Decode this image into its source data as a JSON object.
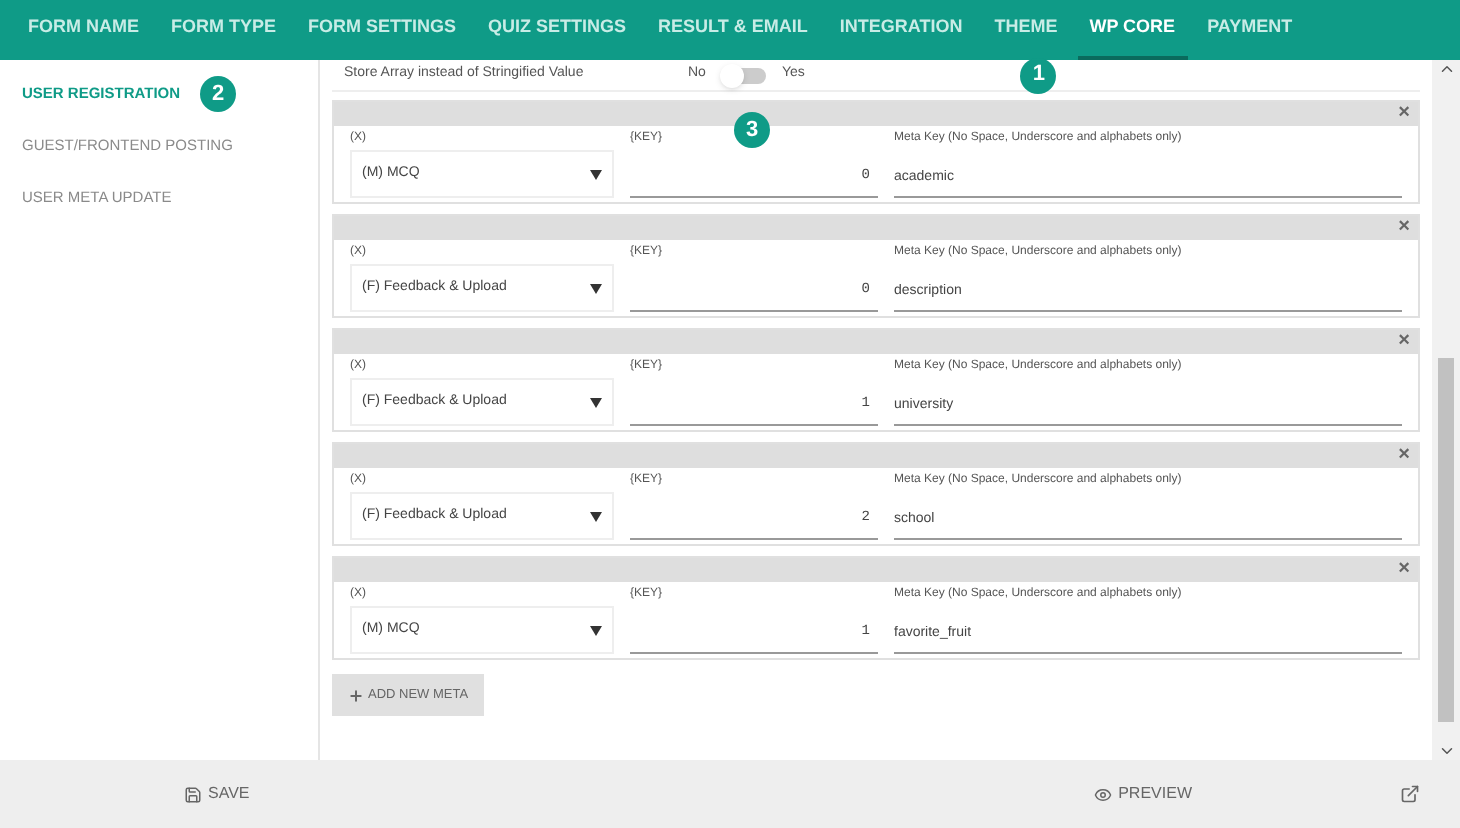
{
  "tabs": [
    {
      "label": "FORM NAME",
      "selected": false
    },
    {
      "label": "FORM TYPE",
      "selected": false
    },
    {
      "label": "FORM SETTINGS",
      "selected": false
    },
    {
      "label": "QUIZ SETTINGS",
      "selected": false
    },
    {
      "label": "RESULT & EMAIL",
      "selected": false
    },
    {
      "label": "INTEGRATION",
      "selected": false
    },
    {
      "label": "THEME",
      "selected": false
    },
    {
      "label": "WP CORE",
      "selected": true
    },
    {
      "label": "PAYMENT",
      "selected": false
    }
  ],
  "markers": [
    "1",
    "2",
    "3"
  ],
  "sidebar": {
    "items": [
      {
        "label": "USER REGISTRATION",
        "selected": true
      },
      {
        "label": "GUEST/FRONTEND POSTING",
        "selected": false
      },
      {
        "label": "USER META UPDATE",
        "selected": false
      }
    ]
  },
  "store_array": {
    "label": "Store Array instead of Stringified Value",
    "off_label": "No",
    "on_label": "Yes",
    "on": false
  },
  "meta_rows": [
    {
      "x_label": "(X)",
      "x_value": "(M) MCQ",
      "key_label": "{KEY}",
      "key_value": "0",
      "meta_label": "Meta Key (No Space, Underscore and alphabets only)",
      "meta_value": "academic",
      "close": "×"
    },
    {
      "x_label": "(X)",
      "x_value": "(F) Feedback & Upload",
      "key_label": "{KEY}",
      "key_value": "0",
      "meta_label": "Meta Key (No Space, Underscore and alphabets only)",
      "meta_value": "description",
      "close": "×"
    },
    {
      "x_label": "(X)",
      "x_value": "(F) Feedback & Upload",
      "key_label": "{KEY}",
      "key_value": "1",
      "meta_label": "Meta Key (No Space, Underscore and alphabets only)",
      "meta_value": "university",
      "close": "×"
    },
    {
      "x_label": "(X)",
      "x_value": "(F) Feedback & Upload",
      "key_label": "{KEY}",
      "key_value": "2",
      "meta_label": "Meta Key (No Space, Underscore and alphabets only)",
      "meta_value": "school",
      "close": "×"
    },
    {
      "x_label": "(X)",
      "x_value": "(M) MCQ",
      "key_label": "{KEY}",
      "key_value": "1",
      "meta_label": "Meta Key (No Space, Underscore and alphabets only)",
      "meta_value": "favorite_fruit",
      "close": "×"
    }
  ],
  "add_button": "ADD NEW META",
  "footer": {
    "save": "SAVE",
    "preview": "PREVIEW"
  }
}
